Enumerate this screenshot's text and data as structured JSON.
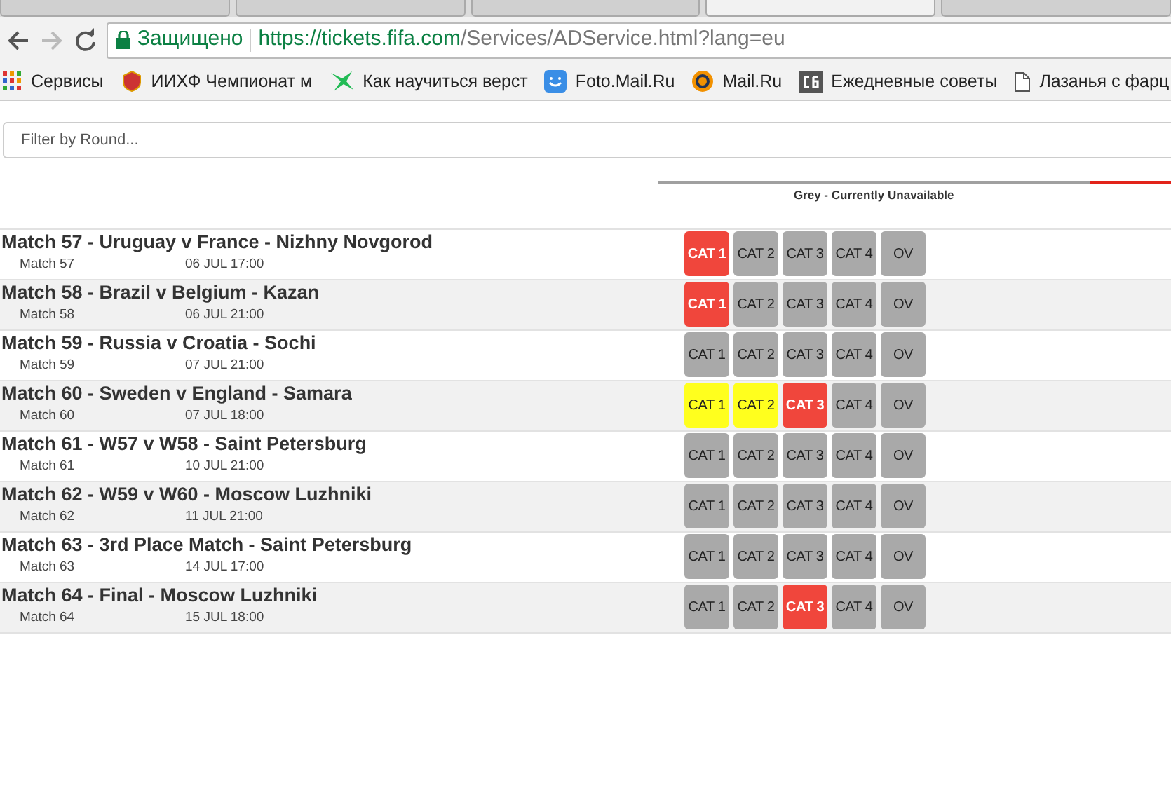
{
  "browser": {
    "tabs": [
      {
        "selected": false
      },
      {
        "selected": false
      },
      {
        "selected": false
      },
      {
        "selected": true
      },
      {
        "selected": false
      }
    ],
    "secure_label": "Защищено",
    "url_host": "https://tickets.fifa.com",
    "url_path": "/Services/ADService.html?lang=eu",
    "bookmarks": [
      {
        "kind": "apps",
        "label": "Сервисы"
      },
      {
        "kind": "crest",
        "label": "ИИХФ Чемпионат м"
      },
      {
        "kind": "star",
        "label": "Как научиться верст"
      },
      {
        "kind": "smile",
        "label": "Foto.Mail.Ru"
      },
      {
        "kind": "at",
        "label": "Mail.Ru"
      },
      {
        "kind": "cb",
        "label": "Ежедневные советы"
      },
      {
        "kind": "page",
        "label": "Лазанья с фарц"
      }
    ]
  },
  "filter": {
    "placeholder": "Filter by Round..."
  },
  "legend": [
    {
      "label": "Grey - Currently Unavailable",
      "color": "#a0a0a0"
    },
    {
      "color": "#e2231a"
    }
  ],
  "matches": [
    {
      "title": "Match 57 - Uruguay v France - Nizhny Novgorod",
      "number": "Match 57",
      "date": "06 JUL 17:00",
      "categories": [
        {
          "label": "CAT 1",
          "color": "#f0463c"
        },
        {
          "label": "CAT 2",
          "color": "#a9a9a9"
        },
        {
          "label": "CAT 3",
          "color": "#a9a9a9"
        },
        {
          "label": "CAT 4",
          "color": "#a9a9a9"
        },
        {
          "label": "OV",
          "color": "#a9a9a9"
        }
      ]
    },
    {
      "title": "Match 58 - Brazil v Belgium - Kazan",
      "number": "Match 58",
      "date": "06 JUL 21:00",
      "categories": [
        {
          "label": "CAT 1",
          "color": "#f0463c"
        },
        {
          "label": "CAT 2",
          "color": "#a9a9a9"
        },
        {
          "label": "CAT 3",
          "color": "#a9a9a9"
        },
        {
          "label": "CAT 4",
          "color": "#a9a9a9"
        },
        {
          "label": "OV",
          "color": "#a9a9a9"
        }
      ]
    },
    {
      "title": "Match 59 - Russia v Croatia - Sochi",
      "number": "Match 59",
      "date": "07 JUL 21:00",
      "categories": [
        {
          "label": "CAT 1",
          "color": "#a9a9a9"
        },
        {
          "label": "CAT 2",
          "color": "#a9a9a9"
        },
        {
          "label": "CAT 3",
          "color": "#a9a9a9"
        },
        {
          "label": "CAT 4",
          "color": "#a9a9a9"
        },
        {
          "label": "OV",
          "color": "#a9a9a9"
        }
      ]
    },
    {
      "title": "Match 60 - Sweden v England - Samara",
      "number": "Match 60",
      "date": "07 JUL 18:00",
      "categories": [
        {
          "label": "CAT 1",
          "color": "#ffff1e"
        },
        {
          "label": "CAT 2",
          "color": "#ffff1e"
        },
        {
          "label": "CAT 3",
          "color": "#f0463c"
        },
        {
          "label": "CAT 4",
          "color": "#a9a9a9"
        },
        {
          "label": "OV",
          "color": "#a9a9a9"
        }
      ]
    },
    {
      "title": "Match 61 - W57 v W58 - Saint Petersburg",
      "number": "Match 61",
      "date": "10 JUL 21:00",
      "categories": [
        {
          "label": "CAT 1",
          "color": "#a9a9a9"
        },
        {
          "label": "CAT 2",
          "color": "#a9a9a9"
        },
        {
          "label": "CAT 3",
          "color": "#a9a9a9"
        },
        {
          "label": "CAT 4",
          "color": "#a9a9a9"
        },
        {
          "label": "OV",
          "color": "#a9a9a9"
        }
      ]
    },
    {
      "title": "Match 62 - W59 v W60 - Moscow Luzhniki",
      "number": "Match 62",
      "date": "11 JUL 21:00",
      "categories": [
        {
          "label": "CAT 1",
          "color": "#a9a9a9"
        },
        {
          "label": "CAT 2",
          "color": "#a9a9a9"
        },
        {
          "label": "CAT 3",
          "color": "#a9a9a9"
        },
        {
          "label": "CAT 4",
          "color": "#a9a9a9"
        },
        {
          "label": "OV",
          "color": "#a9a9a9"
        }
      ]
    },
    {
      "title": "Match 63 - 3rd Place Match - Saint Petersburg",
      "number": "Match 63",
      "date": "14 JUL 17:00",
      "categories": [
        {
          "label": "CAT 1",
          "color": "#a9a9a9"
        },
        {
          "label": "CAT 2",
          "color": "#a9a9a9"
        },
        {
          "label": "CAT 3",
          "color": "#a9a9a9"
        },
        {
          "label": "CAT 4",
          "color": "#a9a9a9"
        },
        {
          "label": "OV",
          "color": "#a9a9a9"
        }
      ]
    },
    {
      "title": "Match 64 - Final - Moscow Luzhniki",
      "number": "Match 64",
      "date": "15 JUL 18:00",
      "categories": [
        {
          "label": "CAT 1",
          "color": "#a9a9a9"
        },
        {
          "label": "CAT 2",
          "color": "#a9a9a9"
        },
        {
          "label": "CAT 3",
          "color": "#f0463c"
        },
        {
          "label": "CAT 4",
          "color": "#a9a9a9"
        },
        {
          "label": "OV",
          "color": "#a9a9a9"
        }
      ]
    }
  ]
}
